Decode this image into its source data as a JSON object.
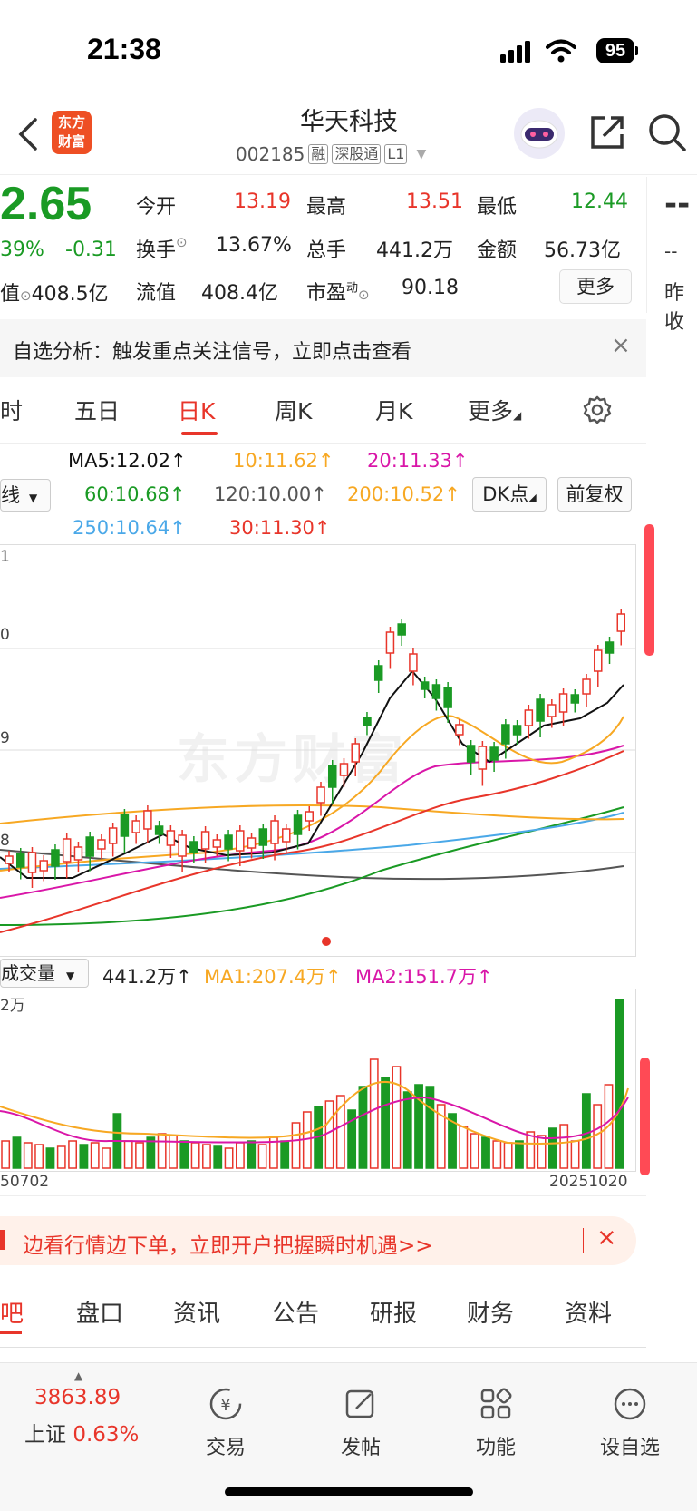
{
  "status": {
    "time": "21:38",
    "battery": "95"
  },
  "header": {
    "logo_line1": "东方",
    "logo_line2": "财富",
    "title": "华天科技",
    "code": "002185",
    "tags": [
      "融",
      "深股通",
      "L1"
    ]
  },
  "quote": {
    "price": "2.65",
    "change_pct": "39%",
    "change": "-0.31",
    "mcap_label": "值",
    "mcap": "408.5亿",
    "open_label": "今开",
    "open": "13.19",
    "high_label": "最高",
    "high": "13.51",
    "low_label": "最低",
    "low": "12.44",
    "turnover_label": "换手",
    "turnover": "13.67%",
    "volume_label": "总手",
    "volume": "441.2万",
    "amount_label": "金额",
    "amount": "56.73亿",
    "float_label": "流值",
    "float": "408.4亿",
    "pe_label": "市盈",
    "pe_sup": "动",
    "pe": "90.18",
    "more": "更多",
    "right_top": "--",
    "right_mid": "--",
    "right_bottom": "昨收"
  },
  "alert": {
    "text": "自选分析：触发重点关注信号，立即点击查看",
    "close": "×"
  },
  "tabs": [
    "时",
    "五日",
    "日K",
    "周K",
    "月K",
    "更多"
  ],
  "ma_legend": {
    "ma5": "MA5:12.02↑",
    "ma10": "10:11.62↑",
    "ma20": "20:11.33↑",
    "ma60": "60:10.68↑",
    "ma120": "120:10.00↑",
    "ma200": "200:10.52↑",
    "ma250": "250:10.64↑",
    "ma30": "30:11.30↑",
    "line_select": "线",
    "dk_btn": "DK点",
    "fq_btn": "前复权",
    "colors": {
      "ma5": "#111111",
      "ma10": "#f7a823",
      "ma20": "#d916a8",
      "ma60": "#1a9a24",
      "ma120": "#555555",
      "ma200": "#f7a823",
      "ma250": "#4aa8e8",
      "ma30": "#e8352a"
    }
  },
  "kline": {
    "axis_labels": [
      "1",
      "0",
      "9",
      "8"
    ],
    "watermark": "东方财富"
  },
  "volume": {
    "select": "成交量",
    "value": "441.2万↑",
    "ma1": "MA1:207.4万↑",
    "ma2": "MA2:151.7万↑",
    "top_label": "2万",
    "date_start": "50702",
    "date_end": "20251020"
  },
  "banner": {
    "text": "边看行情边下单，立即开户把握瞬时机遇>>",
    "close": "×"
  },
  "footer_tabs": [
    "吧",
    "盘口",
    "资讯",
    "公告",
    "研报",
    "财务",
    "资料"
  ],
  "bottom_nav": {
    "index_value": "3863.89",
    "index_name": "上证",
    "index_pct": "0.63%",
    "items": [
      "交易",
      "发帖",
      "功能",
      "设自选"
    ]
  }
}
